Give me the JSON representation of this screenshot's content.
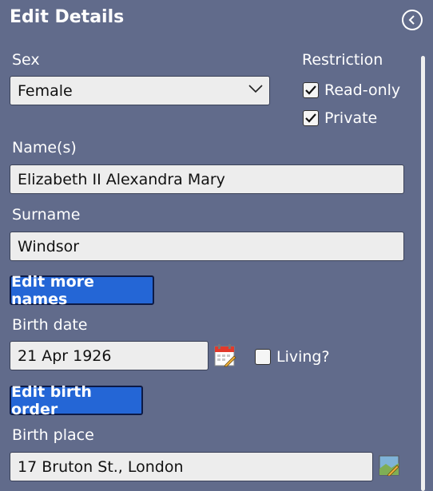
{
  "panel": {
    "title": "Edit Details",
    "back_icon": "chevron-left-circle-icon"
  },
  "sex": {
    "label": "Sex",
    "value": "Female"
  },
  "restriction": {
    "label": "Restriction",
    "read_only": {
      "label": "Read-only",
      "checked": true
    },
    "private": {
      "label": "Private",
      "checked": true
    }
  },
  "names": {
    "label": "Name(s)",
    "value": "Elizabeth II Alexandra Mary"
  },
  "surname": {
    "label": "Surname",
    "value": "Windsor"
  },
  "edit_more_names_label": "Edit more names",
  "birth_date": {
    "label": "Birth date",
    "value": "21 Apr 1926",
    "calendar_icon": "calendar-icon"
  },
  "living": {
    "label": "Living?",
    "checked": false
  },
  "edit_birth_order_label": "Edit birth order",
  "birth_place": {
    "label": "Birth place",
    "value": "17 Bruton St., London",
    "map_icon": "map-icon"
  },
  "colors": {
    "panel_bg": "#616b8b",
    "accent_button": "#2466d6",
    "field_bg": "#ededed"
  }
}
